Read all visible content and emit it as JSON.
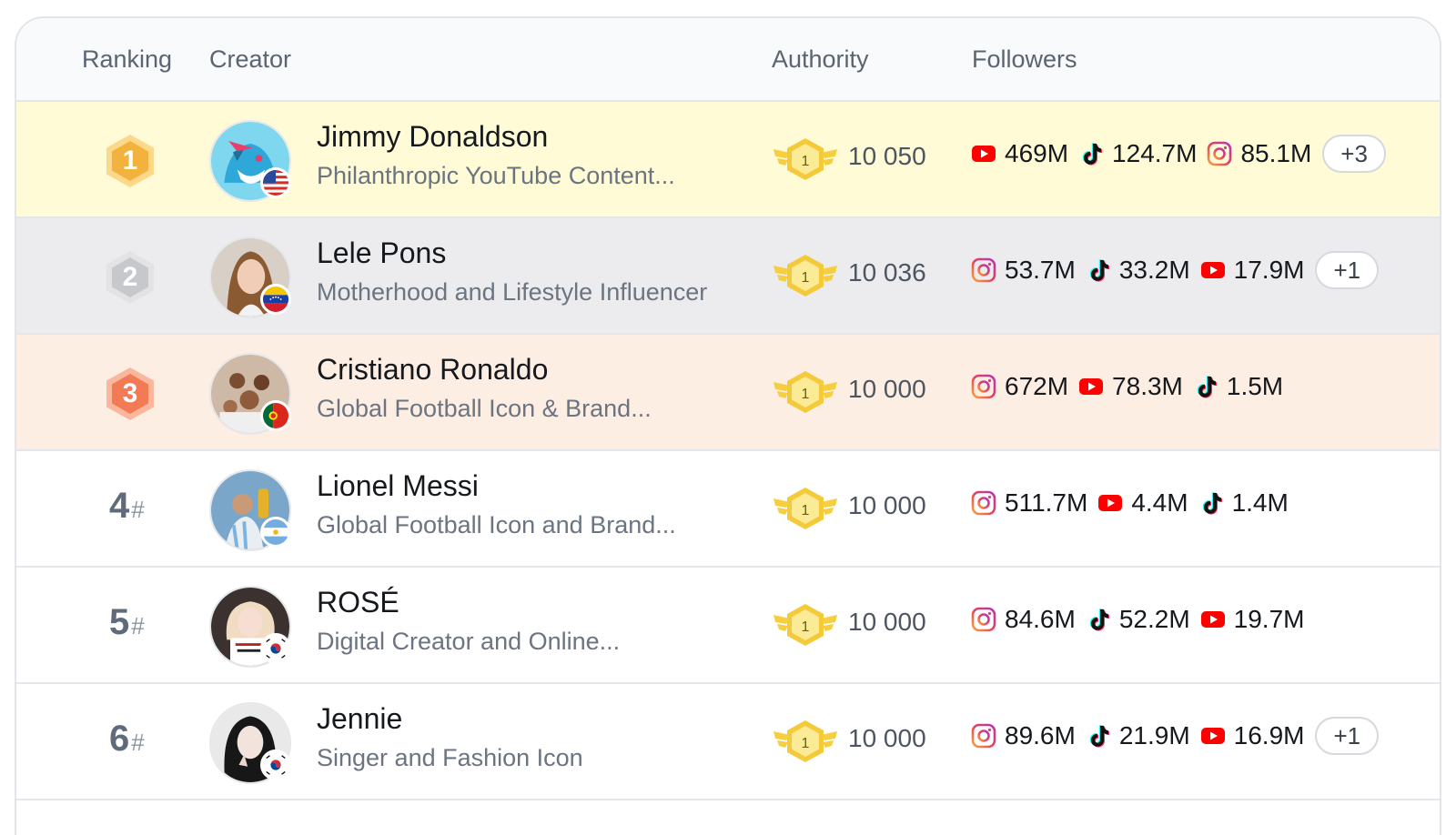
{
  "columns": {
    "ranking": "Ranking",
    "creator": "Creator",
    "authority": "Authority",
    "followers": "Followers"
  },
  "colors": {
    "gold_row": "#fefbd6",
    "silver_row": "#ececee",
    "bronze_row": "#fdeee3",
    "youtube": "#ff0000",
    "instagram": "#e4405f",
    "tiktok": "#111111"
  },
  "rows": [
    {
      "rank": "1",
      "style": "gold",
      "name": "Jimmy Donaldson",
      "desc": "Philanthropic YouTube Content...",
      "authority_level": "1",
      "authority": "10 050",
      "flag": "us-flag-icon",
      "followers": [
        {
          "platform": "youtube-icon",
          "value": "469M"
        },
        {
          "platform": "tiktok-icon",
          "value": "124.7M"
        },
        {
          "platform": "instagram-icon",
          "value": "85.1M"
        }
      ],
      "more": "+3"
    },
    {
      "rank": "2",
      "style": "silver",
      "name": "Lele Pons",
      "desc": "Motherhood and Lifestyle Influencer",
      "authority_level": "1",
      "authority": "10 036",
      "flag": "venezuela-flag-icon",
      "followers": [
        {
          "platform": "instagram-icon",
          "value": "53.7M"
        },
        {
          "platform": "tiktok-icon",
          "value": "33.2M"
        },
        {
          "platform": "youtube-icon",
          "value": "17.9M"
        }
      ],
      "more": "+1"
    },
    {
      "rank": "3",
      "style": "bronze",
      "name": "Cristiano Ronaldo",
      "desc": "Global Football Icon & Brand...",
      "authority_level": "1",
      "authority": "10 000",
      "flag": "portugal-flag-icon",
      "followers": [
        {
          "platform": "instagram-icon",
          "value": "672M"
        },
        {
          "platform": "youtube-icon",
          "value": "78.3M"
        },
        {
          "platform": "tiktok-icon",
          "value": "1.5M"
        }
      ],
      "more": ""
    },
    {
      "rank": "4",
      "hash": "#",
      "style": "plain",
      "name": "Lionel Messi",
      "desc": "Global Football Icon and Brand...",
      "authority_level": "1",
      "authority": "10 000",
      "flag": "argentina-flag-icon",
      "followers": [
        {
          "platform": "instagram-icon",
          "value": "511.7M"
        },
        {
          "platform": "youtube-icon",
          "value": "4.4M"
        },
        {
          "platform": "tiktok-icon",
          "value": "1.4M"
        }
      ],
      "more": ""
    },
    {
      "rank": "5",
      "hash": "#",
      "style": "plain",
      "name": "ROSÉ",
      "desc": "Digital Creator and Online...",
      "authority_level": "1",
      "authority": "10 000",
      "flag": "korea-flag-icon",
      "followers": [
        {
          "platform": "instagram-icon",
          "value": "84.6M"
        },
        {
          "platform": "tiktok-icon",
          "value": "52.2M"
        },
        {
          "platform": "youtube-icon",
          "value": "19.7M"
        }
      ],
      "more": ""
    },
    {
      "rank": "6",
      "hash": "#",
      "style": "plain",
      "name": "Jennie",
      "desc": "Singer and Fashion Icon",
      "authority_level": "1",
      "authority": "10 000",
      "flag": "korea-flag-icon",
      "followers": [
        {
          "platform": "instagram-icon",
          "value": "89.6M"
        },
        {
          "platform": "tiktok-icon",
          "value": "21.9M"
        },
        {
          "platform": "youtube-icon",
          "value": "16.9M"
        }
      ],
      "more": "+1"
    }
  ]
}
